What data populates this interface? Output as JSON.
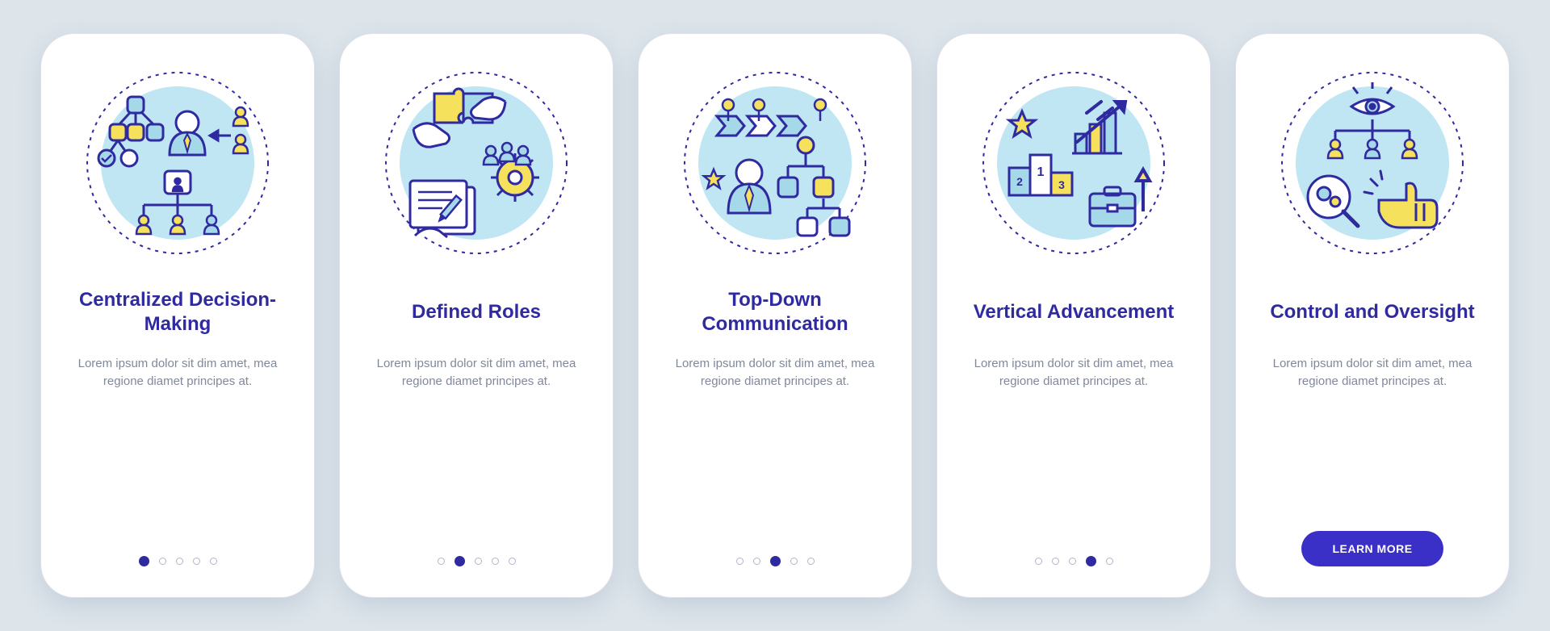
{
  "cards": [
    {
      "icon_name": "centralized-decision-icon",
      "title": "Centralized Decision-Making",
      "body": "Lorem ipsum dolor sit dim amet, mea regione diamet principes at.",
      "footer_type": "dots",
      "active_index": 0,
      "dot_count": 5
    },
    {
      "icon_name": "defined-roles-icon",
      "title": "Defined Roles",
      "body": "Lorem ipsum dolor sit dim amet, mea regione diamet principes at.",
      "footer_type": "dots",
      "active_index": 1,
      "dot_count": 5
    },
    {
      "icon_name": "top-down-communication-icon",
      "title": "Top-Down Communication",
      "body": "Lorem ipsum dolor sit dim amet, mea regione diamet principes at.",
      "footer_type": "dots",
      "active_index": 2,
      "dot_count": 5
    },
    {
      "icon_name": "vertical-advancement-icon",
      "title": "Vertical Advancement",
      "body": "Lorem ipsum dolor sit dim amet, mea regione diamet principes at.",
      "footer_type": "dots",
      "active_index": 3,
      "dot_count": 5
    },
    {
      "icon_name": "control-oversight-icon",
      "title": "Control and Oversight",
      "body": "Lorem ipsum dolor sit dim amet, mea regione diamet principes at.",
      "footer_type": "button",
      "button_label": "LEARN MORE"
    }
  ],
  "colors": {
    "accent": "#2f2aa0",
    "button": "#3a2fc7",
    "yellow": "#f5e15c",
    "lightblue": "#a5d8e8",
    "skyblue": "#bfe6f2",
    "cardbg": "#ffffff",
    "pagebg": "#dde5eb"
  }
}
